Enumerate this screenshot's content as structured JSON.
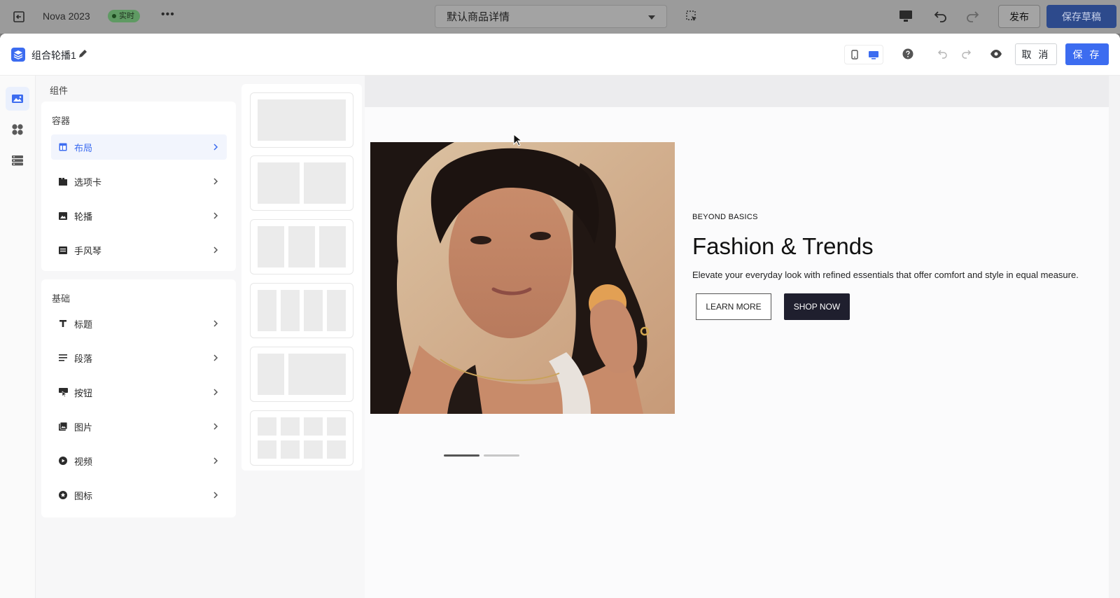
{
  "topbar": {
    "app_name": "Nova 2023",
    "live_badge": "实时",
    "more": "•••",
    "page_select": "默认商品详情",
    "publish_label": "发布",
    "save_draft_label": "保存草稿"
  },
  "panel": {
    "title": "组合轮播1",
    "cancel_label": "取 消",
    "save_label": "保 存"
  },
  "components": {
    "heading": "组件",
    "groups": [
      {
        "title": "容器",
        "items": [
          {
            "label": "布局",
            "icon": "layout-icon",
            "active": true
          },
          {
            "label": "选项卡",
            "icon": "tabs-icon"
          },
          {
            "label": "轮播",
            "icon": "carousel-icon"
          },
          {
            "label": "手风琴",
            "icon": "accordion-icon"
          }
        ]
      },
      {
        "title": "基础",
        "items": [
          {
            "label": "标题",
            "icon": "heading-icon"
          },
          {
            "label": "段落",
            "icon": "paragraph-icon"
          },
          {
            "label": "按钮",
            "icon": "button-icon"
          },
          {
            "label": "图片",
            "icon": "image-icon"
          },
          {
            "label": "视频",
            "icon": "video-icon"
          },
          {
            "label": "图标",
            "icon": "icon-icon"
          }
        ]
      }
    ]
  },
  "hero": {
    "eyebrow": "BEYOND BASICS",
    "headline": "Fashion & Trends",
    "description": "Elevate your everyday look with refined essentials that offer comfort and style in equal measure.",
    "learn_more": "LEARN MORE",
    "shop_now": "SHOP NOW"
  },
  "colors": {
    "accent": "#3c6cf0",
    "dark_button": "#1f1f2e",
    "live_green": "#5f9a63"
  }
}
